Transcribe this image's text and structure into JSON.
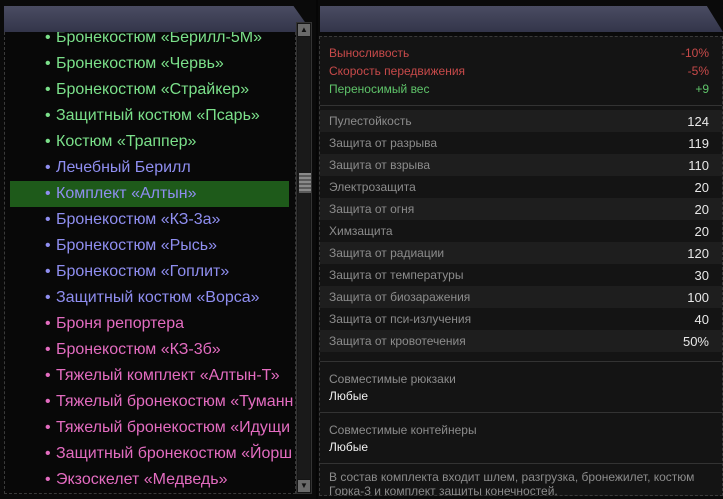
{
  "items_list": {
    "items": [
      {
        "label": "Бронекостюм «Берилл-5М»",
        "color": "#7be08a"
      },
      {
        "label": "Бронекостюм «Червь»",
        "color": "#7be08a"
      },
      {
        "label": "Бронекостюм «Страйкер»",
        "color": "#7be08a"
      },
      {
        "label": "Защитный костюм «Псарь»",
        "color": "#7be08a"
      },
      {
        "label": "Костюм «Траппер»",
        "color": "#7be08a"
      },
      {
        "label": "Лечебный Берилл",
        "color": "#8f8ef0"
      },
      {
        "label": "Комплект «Алтын»",
        "color": "#8f8ef0",
        "selected": true
      },
      {
        "label": "Бронекостюм «КЗ-3а»",
        "color": "#8f8ef0"
      },
      {
        "label": "Бронекостюм «Рысь»",
        "color": "#8f8ef0"
      },
      {
        "label": "Бронекостюм «Гоплит»",
        "color": "#8f8ef0"
      },
      {
        "label": "Защитный костюм «Ворса»",
        "color": "#8f8ef0"
      },
      {
        "label": "Броня репортера",
        "color": "#e36cc0"
      },
      {
        "label": "Бронекостюм «КЗ-3б»",
        "color": "#e36cc0"
      },
      {
        "label": "Тяжелый комплект «Алтын-Т»",
        "color": "#e36cc0"
      },
      {
        "label": "Тяжелый бронекостюм «Туманн",
        "color": "#e36cc0"
      },
      {
        "label": "Тяжелый бронекостюм «Идущи",
        "color": "#e36cc0"
      },
      {
        "label": "Защитный бронекостюм «Йорш",
        "color": "#e36cc0"
      },
      {
        "label": "Экзоскелет «Медведь»",
        "color": "#e36cc0"
      }
    ],
    "bullet": "•"
  },
  "scrollbar": {
    "up_icon": "▲",
    "down_icon": "▼"
  },
  "details": {
    "modifiers": [
      {
        "name": "Выносливость",
        "value": "-10%",
        "color": "#c84a4a"
      },
      {
        "name": "Скорость передвижения",
        "value": "-5%",
        "color": "#c84a4a"
      },
      {
        "name": "Переносимый вес",
        "value": "+9",
        "color": "#5fc46a"
      }
    ],
    "stats": [
      {
        "name": "Пулестойкость",
        "value": "124"
      },
      {
        "name": "Защита от разрыва",
        "value": "119"
      },
      {
        "name": "Защита от взрыва",
        "value": "110"
      },
      {
        "name": "Электрозащита",
        "value": "20"
      },
      {
        "name": "Защита от огня",
        "value": "20"
      },
      {
        "name": "Химзащита",
        "value": "20"
      },
      {
        "name": "Защита от радиации",
        "value": "120"
      },
      {
        "name": "Защита от температуры",
        "value": "30"
      },
      {
        "name": "Защита от биозаражения",
        "value": "100"
      },
      {
        "name": "Защита от пси-излучения",
        "value": "40"
      },
      {
        "name": "Защита от кровотечения",
        "value": "50%"
      }
    ],
    "backpacks_title": "Совместимые рюкзаки",
    "backpacks_value": "Любые",
    "containers_title": "Совместимые контейнеры",
    "containers_value": "Любые",
    "description": "В состав комплекта входит шлем, разгрузка, бронежилет, костюм Горка-3 и комплект защиты конечностей."
  }
}
